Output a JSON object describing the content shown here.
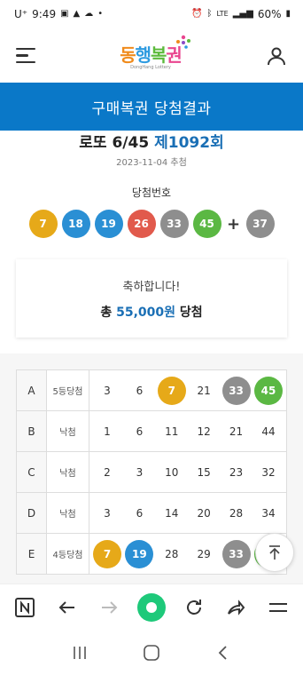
{
  "status_bar": {
    "carrier": "U⁺",
    "time": "9:49",
    "net": "LTE",
    "battery": "60%"
  },
  "header": {
    "logo_text": [
      "동",
      "행",
      "복",
      "권"
    ],
    "logo_sub": "DongHang Lottery"
  },
  "title_bar": {
    "title": "구매복권 당첨결과"
  },
  "round": {
    "game": "로또 6/45",
    "round_label": "제1092회",
    "draw_date": "2023-11-04 추첨"
  },
  "winning": {
    "label": "당첨번호",
    "numbers": [
      {
        "n": "7",
        "color": "#e6a919"
      },
      {
        "n": "18",
        "color": "#2a8fd4"
      },
      {
        "n": "19",
        "color": "#2a8fd4"
      },
      {
        "n": "26",
        "color": "#e15a4c"
      },
      {
        "n": "33",
        "color": "#8e8e8e"
      },
      {
        "n": "45",
        "color": "#5bb843"
      }
    ],
    "plus": "+",
    "bonus": {
      "n": "37",
      "color": "#8e8e8e"
    }
  },
  "congrats": {
    "message": "축하합니다!",
    "prefix": "총",
    "amount": "55,000원",
    "suffix": "당첨"
  },
  "games": [
    {
      "slot": "A",
      "result": "5등당첨",
      "nums": [
        {
          "n": "3"
        },
        {
          "n": "6"
        },
        {
          "n": "7",
          "hit": "#e6a919"
        },
        {
          "n": "21"
        },
        {
          "n": "33",
          "hit": "#8e8e8e"
        },
        {
          "n": "45",
          "hit": "#5bb843"
        }
      ]
    },
    {
      "slot": "B",
      "result": "낙첨",
      "nums": [
        {
          "n": "1"
        },
        {
          "n": "6"
        },
        {
          "n": "11"
        },
        {
          "n": "12"
        },
        {
          "n": "21"
        },
        {
          "n": "44"
        }
      ]
    },
    {
      "slot": "C",
      "result": "낙첨",
      "nums": [
        {
          "n": "2"
        },
        {
          "n": "3"
        },
        {
          "n": "10"
        },
        {
          "n": "15"
        },
        {
          "n": "23"
        },
        {
          "n": "32"
        }
      ]
    },
    {
      "slot": "D",
      "result": "낙첨",
      "nums": [
        {
          "n": "3"
        },
        {
          "n": "6"
        },
        {
          "n": "14"
        },
        {
          "n": "20"
        },
        {
          "n": "28"
        },
        {
          "n": "34"
        }
      ]
    },
    {
      "slot": "E",
      "result": "4등당첨",
      "nums": [
        {
          "n": "7",
          "hit": "#e6a919"
        },
        {
          "n": "19",
          "hit": "#2a8fd4"
        },
        {
          "n": "28"
        },
        {
          "n": "29"
        },
        {
          "n": "33",
          "hit": "#8e8e8e"
        },
        {
          "n": "45",
          "hit": "#5bb843"
        }
      ]
    }
  ],
  "browser_toolbar": {
    "icons": [
      "naver-icon",
      "back-arrow-icon",
      "forward-arrow-icon",
      "home-dot-icon",
      "refresh-icon",
      "share-icon",
      "menu-icon"
    ]
  },
  "colors": {
    "brand_blue": "#0a78c8",
    "accent_blue": "#1a6fb5",
    "home_green": "#1ec97a"
  }
}
